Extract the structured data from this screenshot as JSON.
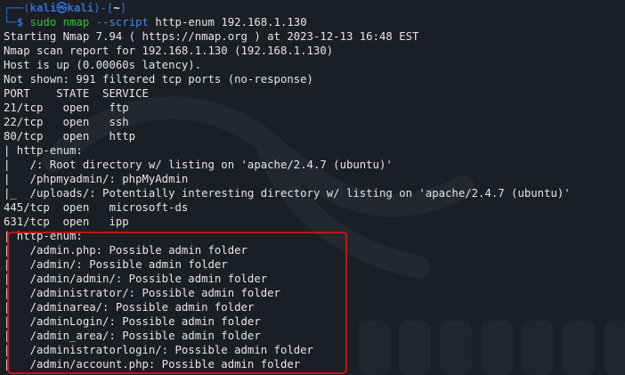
{
  "prompt": {
    "line1_frame_left": "┌──(",
    "user": "kali㉿kali",
    "line1_frame_mid": ")-[",
    "dir": "~",
    "line1_frame_right": "]",
    "line2_frame": "└─",
    "dollar": "$",
    "cmd_name": "sudo",
    "cmd_prog": "nmap",
    "cmd_option": "--script",
    "cmd_args": "http-enum 192.168.1.130"
  },
  "output": [
    "Starting Nmap 7.94 ( https://nmap.org ) at 2023-12-13 16:48 EST",
    "Nmap scan report for 192.168.1.130 (192.168.1.130)",
    "Host is up (0.00060s latency).",
    "Not shown: 991 filtered tcp ports (no-response)",
    "PORT    STATE  SERVICE",
    "21/tcp   open   ftp",
    "22/tcp   open   ssh",
    "80/tcp   open   http",
    "| http-enum:",
    "|   /: Root directory w/ listing on 'apache/2.4.7 (ubuntu)'",
    "|   /phpmyadmin/: phpMyAdmin",
    "|_  /uploads/: Potentially interesting directory w/ listing on 'apache/2.4.7 (ubuntu)'",
    "445/tcp  open   microsoft-ds",
    "631/tcp  open   ipp",
    "| http-enum:",
    "|   /admin.php: Possible admin folder",
    "|   /admin/: Possible admin folder",
    "|   /admin/admin/: Possible admin folder",
    "|   /administrator/: Possible admin folder",
    "|   /adminarea/: Possible admin folder",
    "|   /adminLogin/: Possible admin folder",
    "|   /admin_area/: Possible admin folder",
    "|   /administratorlogin/: Possible admin folder",
    "|   /admin/account.php: Possible admin folder"
  ],
  "colors": {
    "background": "#1b1e24",
    "text": "#e6e6e6",
    "prompt_blue": "#2f6fd8",
    "command_green": "#35c235",
    "option_blue": "#3d8ae8",
    "highlight_red": "#c01717"
  }
}
